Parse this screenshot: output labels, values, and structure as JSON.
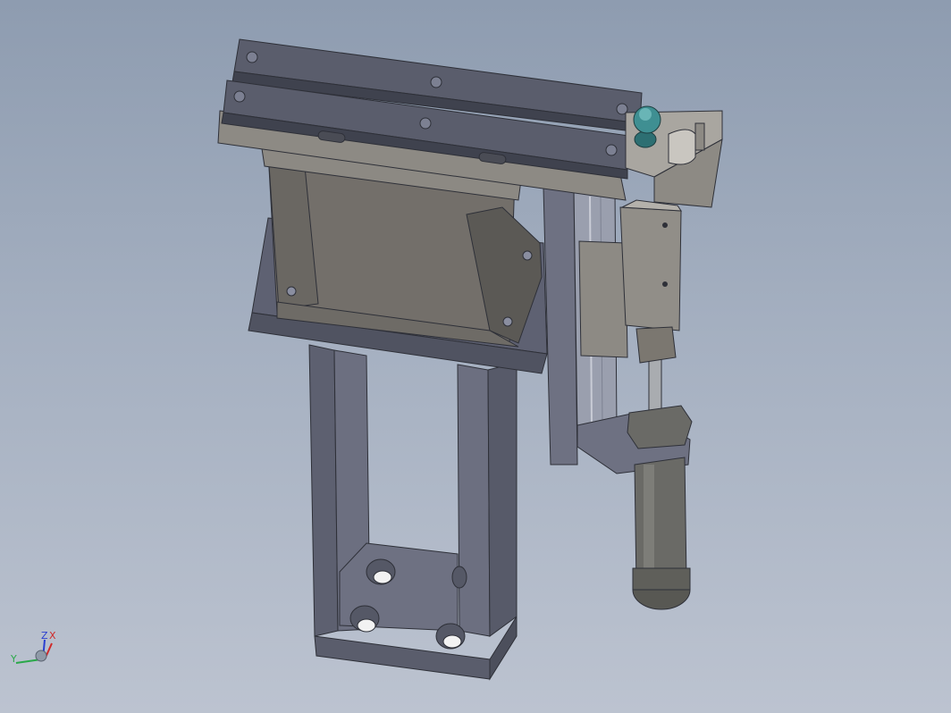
{
  "viewport": {
    "background_top": "#8e9cb0",
    "background_bottom": "#bcc3d0"
  },
  "model": {
    "name": "",
    "colors": {
      "steel_dark": "#5a5d6c",
      "steel_mid": "#6e7182",
      "steel_light": "#8a8ea0",
      "bracket": "#726f6a",
      "bracket_light": "#8c8983",
      "cylinder": "#6a6a66",
      "rod": "#a9acb0",
      "ball_head": "#3f8f92"
    }
  },
  "triad": {
    "z_label": "Z",
    "x_label": "X",
    "y_label": "Y",
    "z_color": "#2a3fd0",
    "x_color": "#d02a2a",
    "y_color": "#2aa84a"
  }
}
